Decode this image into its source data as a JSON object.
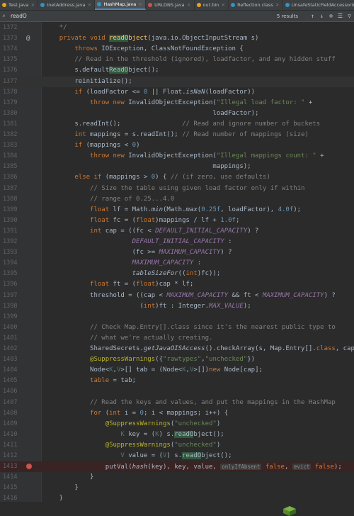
{
  "tabs": [
    {
      "label": "Test.java",
      "color": "#e8a317"
    },
    {
      "label": "InetAddress.java",
      "color": "#3592c4"
    },
    {
      "label": "HashMap.java",
      "color": "#3592c4",
      "active": true
    },
    {
      "label": "URLDNS.java",
      "color": "#c75450"
    },
    {
      "label": "out.bin",
      "color": "#e8a317"
    },
    {
      "label": "Reflection.class",
      "color": "#3592c4"
    },
    {
      "label": "UnsafeStaticFieldAccessorImpl.class",
      "color": "#3592c4"
    }
  ],
  "find": {
    "query": "readO",
    "results": "5 results"
  },
  "lines": [
    {
      "n": "1372",
      "html": "    <span class=\"cm\">*/</span>"
    },
    {
      "n": "1373",
      "anno": "@",
      "html": "    <span class=\"kw\">private void </span><span class=\"fn\"><span class=\"hl\">readO</span>bject</span>(java.io.ObjectInputStream s)"
    },
    {
      "n": "1374",
      "html": "        <span class=\"kw\">throws </span>IOException, ClassNotFoundException {"
    },
    {
      "n": "1375",
      "html": "        <span class=\"cm\">// Read in the threshold (ignored), loadfactor, and any hidden stuff</span>"
    },
    {
      "n": "1376",
      "html": "        s.default<span class=\"hlp\">ReadO</span>bject();"
    },
    {
      "n": "1377",
      "cur": true,
      "html": "        reinitialize();"
    },
    {
      "n": "1378",
      "html": "        <span class=\"kw\">if </span>(loadFactor &lt;= <span class=\"nm\">0 </span>|| Float.<span class=\"it\">isNaN</span>(loadFactor))"
    },
    {
      "n": "1379",
      "html": "            <span class=\"kw\">throw new </span>InvalidObjectException(<span class=\"st\">\"Illegal load factor: \" </span>+"
    },
    {
      "n": "1380",
      "html": "                                            loadFactor);"
    },
    {
      "n": "1381",
      "html": "        s.readInt();                <span class=\"cm\">// Read and ignore number of buckets</span>"
    },
    {
      "n": "1382",
      "html": "        <span class=\"kw\">int </span>mappings = s.readInt(); <span class=\"cm\">// Read number of mappings (size)</span>"
    },
    {
      "n": "1383",
      "html": "        <span class=\"kw\">if </span>(mappings &lt; <span class=\"nm\">0</span>)"
    },
    {
      "n": "1384",
      "html": "            <span class=\"kw\">throw new </span>InvalidObjectException(<span class=\"st\">\"Illegal mappings count: \" </span>+"
    },
    {
      "n": "1385",
      "html": "                                            mappings);"
    },
    {
      "n": "1386",
      "html": "        <span class=\"kw\">else if </span>(mappings &gt; <span class=\"nm\">0</span>) { <span class=\"cm\">// (if zero, use defaults)</span>"
    },
    {
      "n": "1387",
      "html": "            <span class=\"cm\">// Size the table using given load factor only if within</span>"
    },
    {
      "n": "1388",
      "html": "            <span class=\"cm\">// range of 0.25...4.0</span>"
    },
    {
      "n": "1389",
      "html": "            <span class=\"kw\">float </span>lf = Math.<span class=\"it\">min</span>(Math.<span class=\"it\">max</span>(<span class=\"nm\">0.25f</span>, loadFactor), <span class=\"nm\">4.0f</span>);"
    },
    {
      "n": "1390",
      "html": "            <span class=\"kw\">float </span>fc = (<span class=\"kw\">float</span>)mappings / lf + <span class=\"nm\">1.0f</span>;"
    },
    {
      "n": "1391",
      "html": "            <span class=\"kw\">int </span>cap = ((fc &lt; <span class=\"sf\">DEFAULT_INITIAL_CAPACITY</span>) ?"
    },
    {
      "n": "1392",
      "html": "                       <span class=\"sf\">DEFAULT_INITIAL_CAPACITY </span>:"
    },
    {
      "n": "1393",
      "html": "                       (fc &gt;= <span class=\"sf\">MAXIMUM_CAPACITY</span>) ?"
    },
    {
      "n": "1394",
      "html": "                       <span class=\"sf\">MAXIMUM_CAPACITY </span>:"
    },
    {
      "n": "1395",
      "html": "                       <span class=\"it\">tableSizeFor</span>((<span class=\"kw\">int</span>)fc));"
    },
    {
      "n": "1396",
      "html": "            <span class=\"kw\">float </span>ft = (<span class=\"kw\">float</span>)cap * lf;"
    },
    {
      "n": "1397",
      "html": "            threshold = ((cap &lt; <span class=\"sf\">MAXIMUM_CAPACITY </span>&amp;&amp; ft &lt; <span class=\"sf\">MAXIMUM_CAPACITY</span>) ?"
    },
    {
      "n": "1398",
      "html": "                         (<span class=\"kw\">int</span>)ft : Integer.<span class=\"sf\">MAX_VALUE</span>);"
    },
    {
      "n": "1399",
      "html": ""
    },
    {
      "n": "1400",
      "html": "            <span class=\"cm\">// Check Map.Entry[].class since it's the nearest public type to</span>"
    },
    {
      "n": "1401",
      "html": "            <span class=\"cm\">// what we're actually creating.</span>"
    },
    {
      "n": "1402",
      "html": "            SharedSecrets.<span class=\"it\">getJavaOISAccess</span>().checkArray(s, Map.Entry[].<span class=\"kw\">class</span>, cap);"
    },
    {
      "n": "1403",
      "html": "            <span class=\"an\">@SuppressWarnings</span>({<span class=\"st\">\"rawtypes\"</span>,<span class=\"st\">\"unchecked\"</span>})"
    },
    {
      "n": "1404",
      "html": "            Node&lt;<span class=\"tp\">K</span>,<span class=\"tp\">V</span>&gt;[] tab = (Node&lt;<span class=\"tp\">K</span>,<span class=\"tp\">V</span>&gt;[])<span class=\"kw\">new </span>Node[cap];"
    },
    {
      "n": "1405",
      "html": "            <span class=\"kw\">table </span>= tab;"
    },
    {
      "n": "1406",
      "html": ""
    },
    {
      "n": "1407",
      "html": "            <span class=\"cm\">// Read the keys and values, and put the mappings in the HashMap</span>"
    },
    {
      "n": "1408",
      "html": "            <span class=\"kw\">for </span>(<span class=\"kw\">int </span>i = <span class=\"nm\">0</span>; i &lt; mappings; i++) {"
    },
    {
      "n": "1409",
      "html": "                <span class=\"an\">@SuppressWarnings</span>(<span class=\"st\">\"unchecked\"</span>)"
    },
    {
      "n": "1410",
      "html": "                    <span class=\"tp\">K </span>key = (<span class=\"tp\">K</span>) s.<span class=\"hlp\">readO</span>bject();"
    },
    {
      "n": "1411",
      "html": "                <span class=\"an\">@SuppressWarnings</span>(<span class=\"st\">\"unchecked\"</span>)"
    },
    {
      "n": "1412",
      "html": "                    <span class=\"tp\">V </span>value = (<span class=\"tp\">V</span>) s.<span class=\"hlp\">readO</span>bject();"
    },
    {
      "n": "1413",
      "bp": true,
      "html": "                putVal(<span class=\"it\">hash</span>(key), key, value, <span class=\"hint\">onlyIfAbsent</span> <span class=\"kw\">false</span>, <span class=\"hint\">evict</span> <span class=\"kw\">false</span>);"
    },
    {
      "n": "1414",
      "html": "            }"
    },
    {
      "n": "1415",
      "html": "        }"
    },
    {
      "n": "1416",
      "html": "    }"
    }
  ]
}
